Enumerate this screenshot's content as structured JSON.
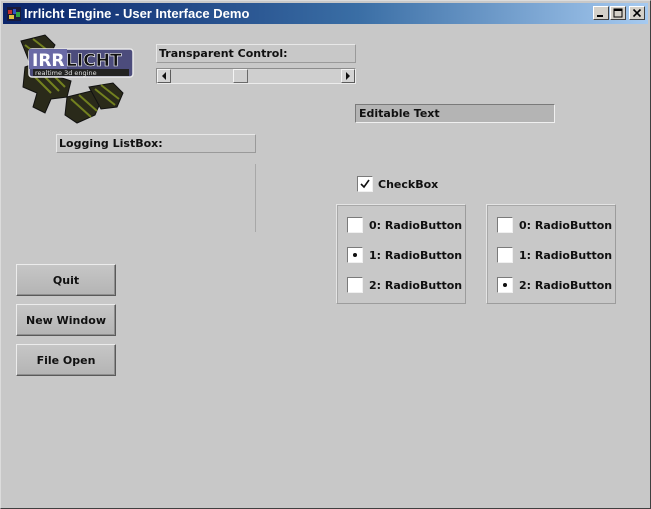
{
  "window": {
    "title": "Irrlicht Engine - User Interface Demo",
    "controls": {
      "minimize": "minimize",
      "maximize": "maximize",
      "close": "close"
    }
  },
  "logo": {
    "line1": "IRRLICHT",
    "line2": "realtime 3d engine"
  },
  "transparent_control": {
    "label": "Transparent Control:",
    "scroll_value_percent": 40
  },
  "edit_box": {
    "value": "Editable Text"
  },
  "logging_listbox": {
    "label": "Logging ListBox:"
  },
  "checkbox": {
    "label": "CheckBox",
    "checked": true
  },
  "radio_groups": [
    {
      "options": [
        "0: RadioButton",
        "1: RadioButton",
        "2: RadioButton"
      ],
      "selected_index": 1
    },
    {
      "options": [
        "0: RadioButton",
        "1: RadioButton",
        "2: RadioButton"
      ],
      "selected_index": 2
    }
  ],
  "buttons": {
    "quit": "Quit",
    "new_window": "New Window",
    "file_open": "File Open"
  },
  "colors": {
    "titlebar_start": "#0a246a",
    "titlebar_end": "#a6caf0",
    "background": "#c8c8c8",
    "logo_text_bg": "#5a5a8a"
  }
}
